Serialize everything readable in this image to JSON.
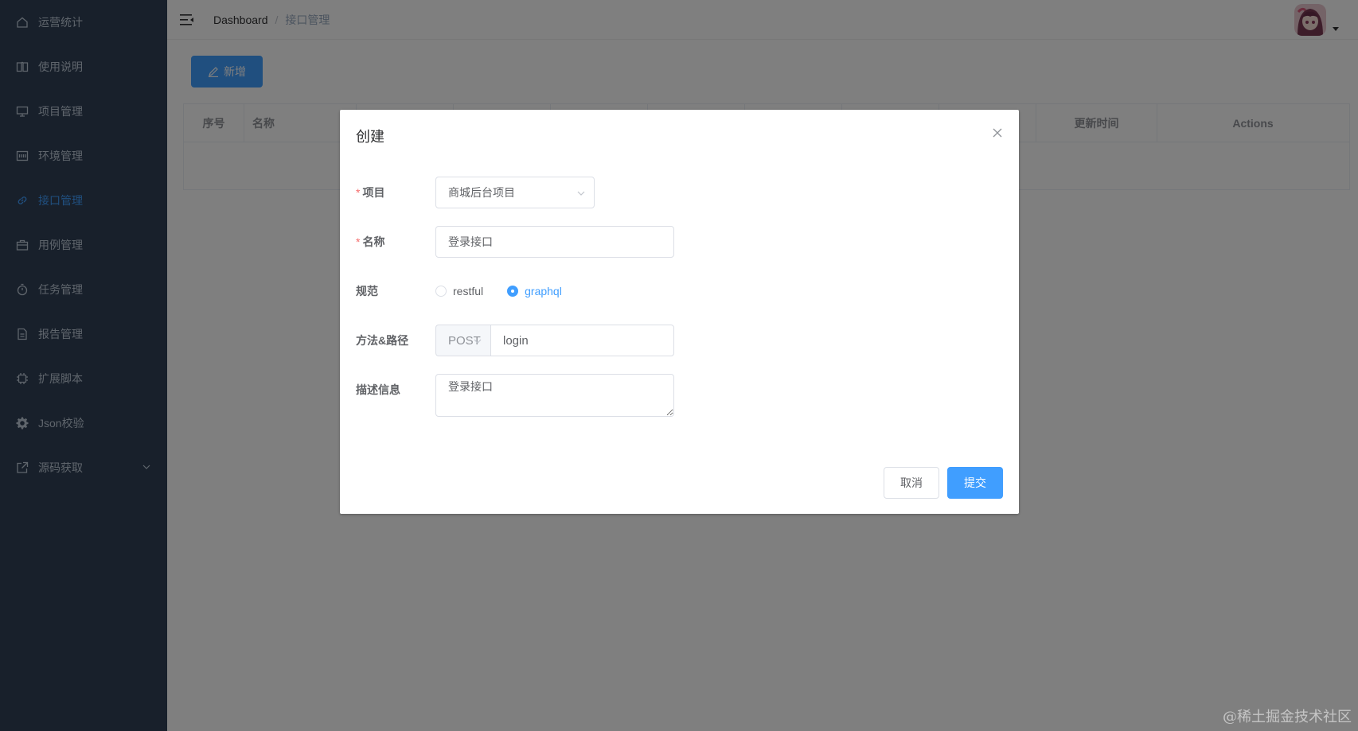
{
  "sidebar": {
    "items": [
      {
        "label": "运营统计",
        "icon": "home-icon"
      },
      {
        "label": "使用说明",
        "icon": "book-icon"
      },
      {
        "label": "项目管理",
        "icon": "monitor-icon"
      },
      {
        "label": "环境管理",
        "icon": "terminal-icon"
      },
      {
        "label": "接口管理",
        "icon": "link-icon",
        "active": true
      },
      {
        "label": "用例管理",
        "icon": "briefcase-icon"
      },
      {
        "label": "任务管理",
        "icon": "timer-icon"
      },
      {
        "label": "报告管理",
        "icon": "document-icon"
      },
      {
        "label": "扩展脚本",
        "icon": "cpu-icon"
      },
      {
        "label": "Json校验",
        "icon": "gear-icon"
      },
      {
        "label": "源码获取",
        "icon": "external-link-icon"
      }
    ],
    "bg_color": "#304156",
    "active_color": "#409eff"
  },
  "header": {
    "breadcrumb": {
      "home": "Dashboard",
      "separator": "/",
      "current": "接口管理"
    }
  },
  "toolbar": {
    "add_label": "新增"
  },
  "table": {
    "columns": {
      "index": "序号",
      "name": "名称",
      "updated": "更新时间",
      "actions": "Actions"
    }
  },
  "dialog": {
    "title": "创建",
    "project": {
      "label": "项目",
      "value": "商城后台项目"
    },
    "name": {
      "label": "名称",
      "value": "登录接口"
    },
    "spec": {
      "label": "规范",
      "options": [
        "restful",
        "graphql"
      ],
      "selected": "graphql"
    },
    "method_path": {
      "label": "方法&路径",
      "method": "POST",
      "path": "login"
    },
    "description": {
      "label": "描述信息",
      "value": "登录接口"
    },
    "cancel_label": "取消",
    "submit_label": "提交"
  },
  "watermark": "@稀土掘金技术社区"
}
